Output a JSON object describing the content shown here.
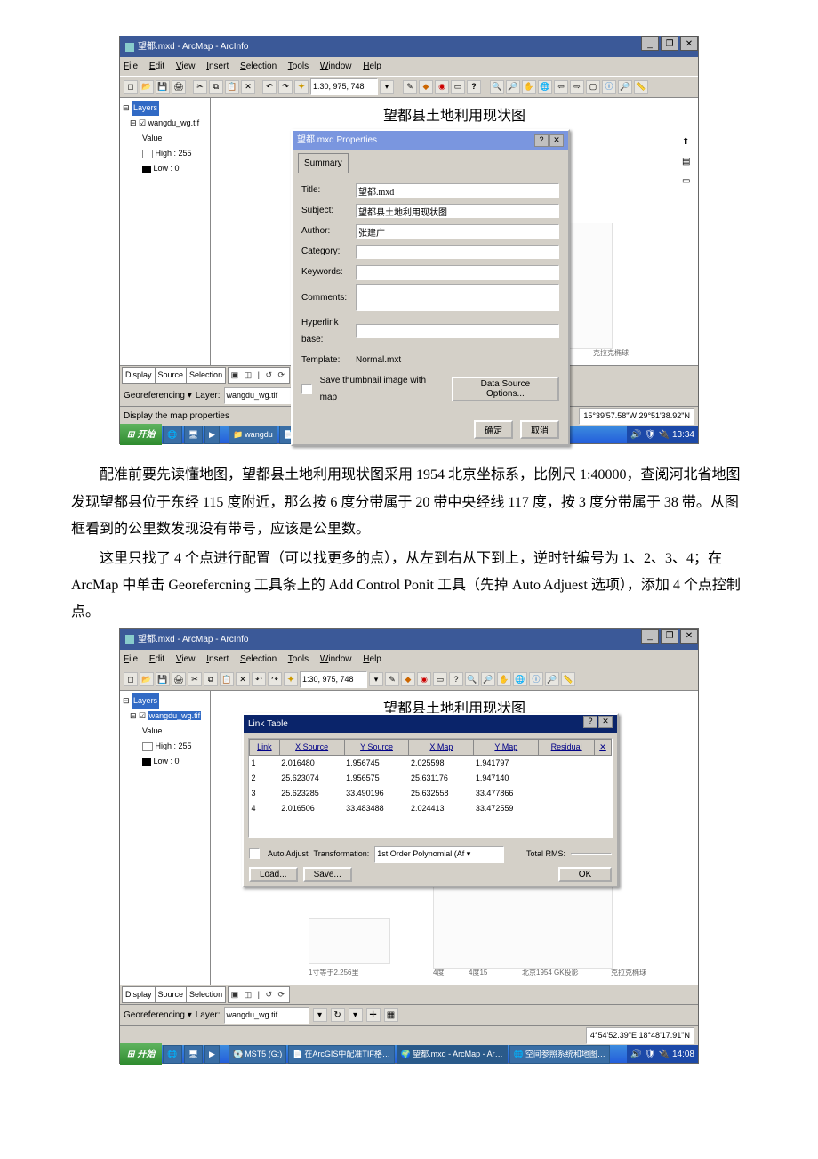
{
  "app_title": "望都.mxd - ArcMap - ArcInfo",
  "menus": {
    "file": "File",
    "edit": "Edit",
    "view": "View",
    "insert": "Insert",
    "selection": "Selection",
    "tools": "Tools",
    "window": "Window",
    "help": "Help"
  },
  "scale": "1:30, 975, 748",
  "toc": {
    "root": "Layers",
    "layer": "wangdu_wg.tif",
    "value": "Value",
    "high": "High : 255",
    "low": "Low : 0"
  },
  "map_title": "望都县土地利用现状图",
  "dialog1": {
    "title": "望都.mxd Properties",
    "tab": "Summary",
    "labels": {
      "title": "Title:",
      "subject": "Subject:",
      "author": "Author:",
      "category": "Category:",
      "keywords": "Keywords:",
      "comments": "Comments:",
      "hyperlink": "Hyperlink base:",
      "template": "Template:"
    },
    "values": {
      "title": "望都.mxd",
      "subject": "望都县土地利用现状图",
      "author": "张建广",
      "template": "Normal.mxt"
    },
    "save_thumb": "Save thumbnail image with map",
    "dsopts": "Data Source Options...",
    "ok": "确定",
    "cancel": "取消"
  },
  "map_scale_text": "1寸等于2.256里",
  "map_coord_left": "4度",
  "map_coord_right": "4度15",
  "map_proj": "北京1954 GK投影",
  "map_ell": "克拉克椭球",
  "tabs_bottom": {
    "display": "Display",
    "source": "Source",
    "selection": "Selection"
  },
  "view_btns": "▣ ◫ | ↺ ⟳",
  "georef": {
    "label": "Georeferencing ▾",
    "layer_lbl": "Layer:",
    "layer": "wangdu_wg.tif"
  },
  "status1": "Display the map properties",
  "coord1": "15°39'57.58\"W  29°51'38.92\"N",
  "taskbar1": {
    "start": "开始",
    "wangdu": "wangdu",
    "doc": "在ArcGIS中配准TIF格…",
    "arcmap": "望都.mxd - ArcMap - Arc…",
    "time": "13:34"
  },
  "para1": "配准前要先读懂地图，望都县土地利用现状图采用 1954 北京坐标系，比例尺 1:40000，查阅河北省地图发现望都县位于东经 115 度附近，那么按 6 度分带属于 20 带中央经线 117 度，按 3 度分带属于 38 带。从图框看到的公里数发现没有带号，应该是公里数。",
  "para2": "这里只找了 4 个点进行配置（可以找更多的点），从左到右从下到上，逆时针编号为 1、2、3、4；在 ArcMap 中单击 Georefercning 工具条上的 Add Control Ponit 工具（先掉 Auto Adjuest 选项），添加 4 个点控制点。",
  "link_table": {
    "title": "Link Table",
    "headers": {
      "link": "Link",
      "xs": "X Source",
      "ys": "Y Source",
      "xm": "X Map",
      "ym": "Y Map",
      "res": "Residual"
    },
    "rows": [
      {
        "link": "1",
        "xs": "2.016480",
        "ys": "1.956745",
        "xm": "2.025598",
        "ym": "1.941797",
        "res": ""
      },
      {
        "link": "2",
        "xs": "25.623074",
        "ys": "1.956575",
        "xm": "25.631176",
        "ym": "1.947140",
        "res": ""
      },
      {
        "link": "3",
        "xs": "25.623285",
        "ys": "33.490196",
        "xm": "25.632558",
        "ym": "33.477866",
        "res": ""
      },
      {
        "link": "4",
        "xs": "2.016506",
        "ys": "33.483488",
        "xm": "2.024413",
        "ym": "33.472559",
        "res": ""
      }
    ],
    "auto": "Auto Adjust",
    "transform_lbl": "Transformation:",
    "transform": "1st Order Polynomial (Af",
    "total": "Total RMS:",
    "load": "Load...",
    "save": "Save...",
    "ok": "OK"
  },
  "coord2": "4°54'52.39\"E  18°48'17.91\"N",
  "taskbar2": {
    "start": "开始",
    "mst": "MST5 (G:)",
    "doc": "在ArcGIS中配准TIF格…",
    "arcmap": "望都.mxd - ArcMap - Ar…",
    "srs": "空间参照系统和地图…",
    "time": "14:08"
  }
}
